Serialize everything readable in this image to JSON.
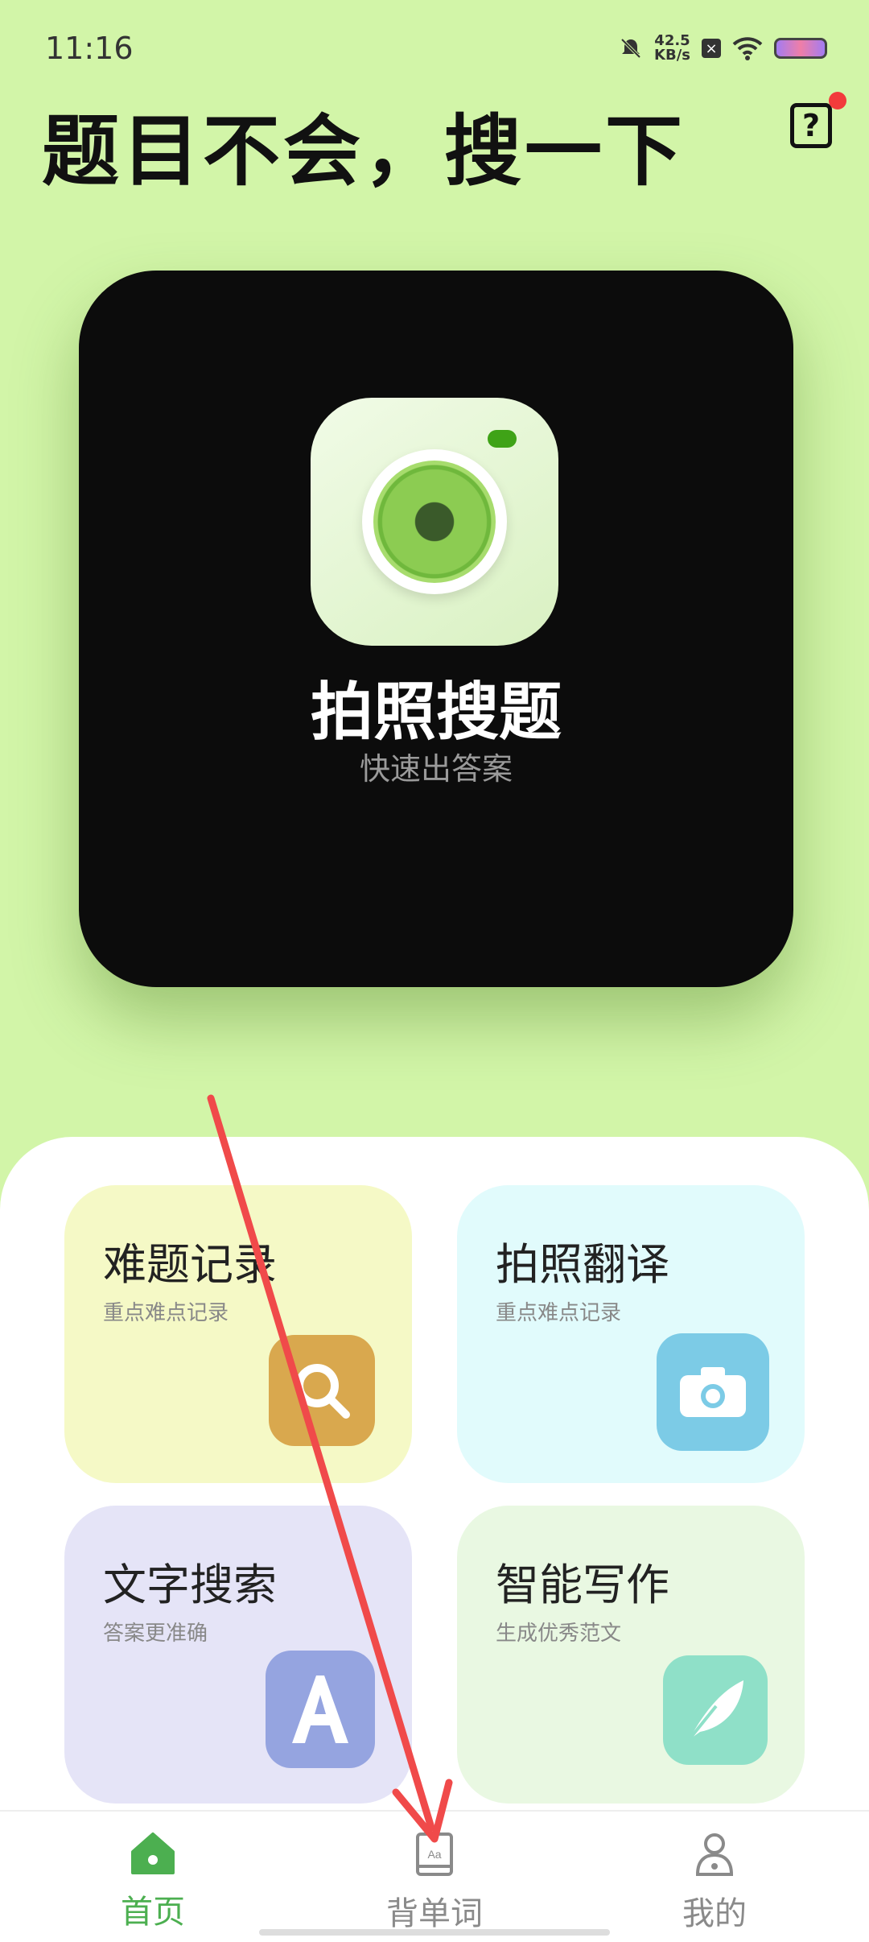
{
  "status": {
    "time": "11:16",
    "speed_value": "42.5",
    "speed_unit": "KB/s"
  },
  "header": {
    "title": "题目不会，搜一下",
    "help_icon": "question-icon"
  },
  "hero": {
    "title": "拍照搜题",
    "subtitle": "快速出答案",
    "icon": "camera-icon"
  },
  "cards": [
    {
      "title": "难题记录",
      "subtitle": "重点难点记录",
      "icon": "search-icon",
      "color": "#d9a84e"
    },
    {
      "title": "拍照翻译",
      "subtitle": "重点难点记录",
      "icon": "camera-icon",
      "color": "#7ccbe6"
    },
    {
      "title": "文字搜索",
      "subtitle": "答案更准确",
      "icon": "letter-a-icon",
      "color": "#95a4e0"
    },
    {
      "title": "智能写作",
      "subtitle": "生成优秀范文",
      "icon": "feather-icon",
      "color": "#8fe0c8"
    }
  ],
  "tabs": [
    {
      "label": "首页",
      "icon": "home-icon",
      "active": true,
      "color": "#4caf50"
    },
    {
      "label": "背单词",
      "icon": "book-icon",
      "active": false,
      "color": "#8a8a8a"
    },
    {
      "label": "我的",
      "icon": "user-icon",
      "active": false,
      "color": "#8a8a8a"
    }
  ],
  "annotation": {
    "arrow_color": "#f04a4a"
  }
}
